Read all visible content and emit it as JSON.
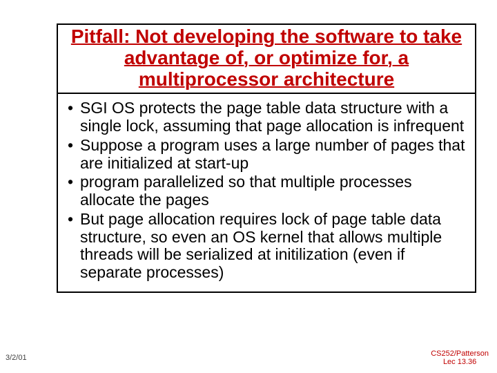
{
  "title": "Pitfall: Not developing the software to take advantage of, or optimize for, a multiprocessor architecture",
  "bullets": [
    "SGI OS protects the page table data structure with a single lock, assuming that page allocation is infrequent",
    "Suppose a program uses a large number of pages that are initialized at start-up",
    "program parallelized so that multiple processes allocate the pages",
    "But page allocation requires lock of page table data structure, so even an OS kernel that allows multiple threads will be serialized at initilization (even if separate processes)"
  ],
  "date": "3/2/01",
  "footer_line1": "CS252/Patterson",
  "footer_line2": "Lec 13.36"
}
